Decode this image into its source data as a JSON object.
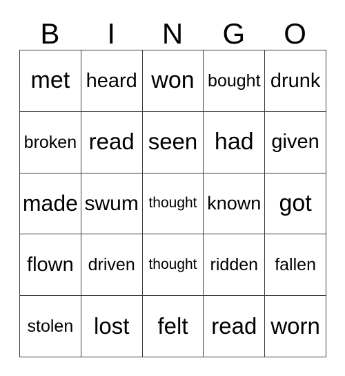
{
  "card": {
    "title": "BINGO",
    "headers": [
      "B",
      "I",
      "N",
      "G",
      "O"
    ],
    "colors": {
      "background": "#ffffff",
      "grid_line": "#3c3c3c",
      "text": "#000000"
    },
    "rows": [
      [
        "met",
        "heard",
        "won",
        "bought",
        "drunk"
      ],
      [
        "broken",
        "read",
        "seen",
        "had",
        "given"
      ],
      [
        "made",
        "swum",
        "thought",
        "known",
        "got"
      ],
      [
        "flown",
        "driven",
        "thought",
        "ridden",
        "fallen"
      ],
      [
        "stolen",
        "lost",
        "felt",
        "read",
        "worn"
      ]
    ]
  }
}
